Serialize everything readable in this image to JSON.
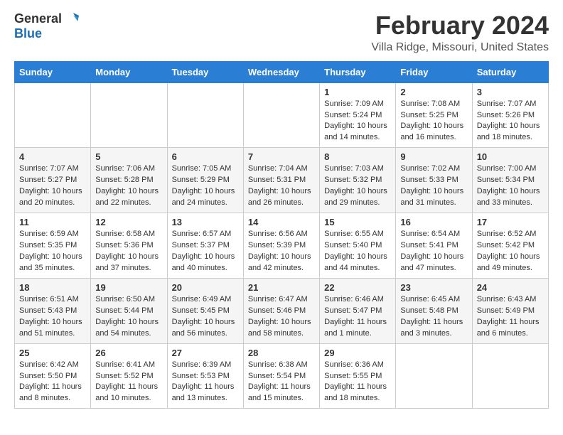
{
  "header": {
    "logo_line1": "General",
    "logo_line2": "Blue",
    "title": "February 2024",
    "subtitle": "Villa Ridge, Missouri, United States"
  },
  "calendar": {
    "weekdays": [
      "Sunday",
      "Monday",
      "Tuesday",
      "Wednesday",
      "Thursday",
      "Friday",
      "Saturday"
    ],
    "weeks": [
      [
        {
          "day": "",
          "info": ""
        },
        {
          "day": "",
          "info": ""
        },
        {
          "day": "",
          "info": ""
        },
        {
          "day": "",
          "info": ""
        },
        {
          "day": "1",
          "info": "Sunrise: 7:09 AM\nSunset: 5:24 PM\nDaylight: 10 hours\nand 14 minutes."
        },
        {
          "day": "2",
          "info": "Sunrise: 7:08 AM\nSunset: 5:25 PM\nDaylight: 10 hours\nand 16 minutes."
        },
        {
          "day": "3",
          "info": "Sunrise: 7:07 AM\nSunset: 5:26 PM\nDaylight: 10 hours\nand 18 minutes."
        }
      ],
      [
        {
          "day": "4",
          "info": "Sunrise: 7:07 AM\nSunset: 5:27 PM\nDaylight: 10 hours\nand 20 minutes."
        },
        {
          "day": "5",
          "info": "Sunrise: 7:06 AM\nSunset: 5:28 PM\nDaylight: 10 hours\nand 22 minutes."
        },
        {
          "day": "6",
          "info": "Sunrise: 7:05 AM\nSunset: 5:29 PM\nDaylight: 10 hours\nand 24 minutes."
        },
        {
          "day": "7",
          "info": "Sunrise: 7:04 AM\nSunset: 5:31 PM\nDaylight: 10 hours\nand 26 minutes."
        },
        {
          "day": "8",
          "info": "Sunrise: 7:03 AM\nSunset: 5:32 PM\nDaylight: 10 hours\nand 29 minutes."
        },
        {
          "day": "9",
          "info": "Sunrise: 7:02 AM\nSunset: 5:33 PM\nDaylight: 10 hours\nand 31 minutes."
        },
        {
          "day": "10",
          "info": "Sunrise: 7:00 AM\nSunset: 5:34 PM\nDaylight: 10 hours\nand 33 minutes."
        }
      ],
      [
        {
          "day": "11",
          "info": "Sunrise: 6:59 AM\nSunset: 5:35 PM\nDaylight: 10 hours\nand 35 minutes."
        },
        {
          "day": "12",
          "info": "Sunrise: 6:58 AM\nSunset: 5:36 PM\nDaylight: 10 hours\nand 37 minutes."
        },
        {
          "day": "13",
          "info": "Sunrise: 6:57 AM\nSunset: 5:37 PM\nDaylight: 10 hours\nand 40 minutes."
        },
        {
          "day": "14",
          "info": "Sunrise: 6:56 AM\nSunset: 5:39 PM\nDaylight: 10 hours\nand 42 minutes."
        },
        {
          "day": "15",
          "info": "Sunrise: 6:55 AM\nSunset: 5:40 PM\nDaylight: 10 hours\nand 44 minutes."
        },
        {
          "day": "16",
          "info": "Sunrise: 6:54 AM\nSunset: 5:41 PM\nDaylight: 10 hours\nand 47 minutes."
        },
        {
          "day": "17",
          "info": "Sunrise: 6:52 AM\nSunset: 5:42 PM\nDaylight: 10 hours\nand 49 minutes."
        }
      ],
      [
        {
          "day": "18",
          "info": "Sunrise: 6:51 AM\nSunset: 5:43 PM\nDaylight: 10 hours\nand 51 minutes."
        },
        {
          "day": "19",
          "info": "Sunrise: 6:50 AM\nSunset: 5:44 PM\nDaylight: 10 hours\nand 54 minutes."
        },
        {
          "day": "20",
          "info": "Sunrise: 6:49 AM\nSunset: 5:45 PM\nDaylight: 10 hours\nand 56 minutes."
        },
        {
          "day": "21",
          "info": "Sunrise: 6:47 AM\nSunset: 5:46 PM\nDaylight: 10 hours\nand 58 minutes."
        },
        {
          "day": "22",
          "info": "Sunrise: 6:46 AM\nSunset: 5:47 PM\nDaylight: 11 hours\nand 1 minute."
        },
        {
          "day": "23",
          "info": "Sunrise: 6:45 AM\nSunset: 5:48 PM\nDaylight: 11 hours\nand 3 minutes."
        },
        {
          "day": "24",
          "info": "Sunrise: 6:43 AM\nSunset: 5:49 PM\nDaylight: 11 hours\nand 6 minutes."
        }
      ],
      [
        {
          "day": "25",
          "info": "Sunrise: 6:42 AM\nSunset: 5:50 PM\nDaylight: 11 hours\nand 8 minutes."
        },
        {
          "day": "26",
          "info": "Sunrise: 6:41 AM\nSunset: 5:52 PM\nDaylight: 11 hours\nand 10 minutes."
        },
        {
          "day": "27",
          "info": "Sunrise: 6:39 AM\nSunset: 5:53 PM\nDaylight: 11 hours\nand 13 minutes."
        },
        {
          "day": "28",
          "info": "Sunrise: 6:38 AM\nSunset: 5:54 PM\nDaylight: 11 hours\nand 15 minutes."
        },
        {
          "day": "29",
          "info": "Sunrise: 6:36 AM\nSunset: 5:55 PM\nDaylight: 11 hours\nand 18 minutes."
        },
        {
          "day": "",
          "info": ""
        },
        {
          "day": "",
          "info": ""
        }
      ]
    ]
  }
}
